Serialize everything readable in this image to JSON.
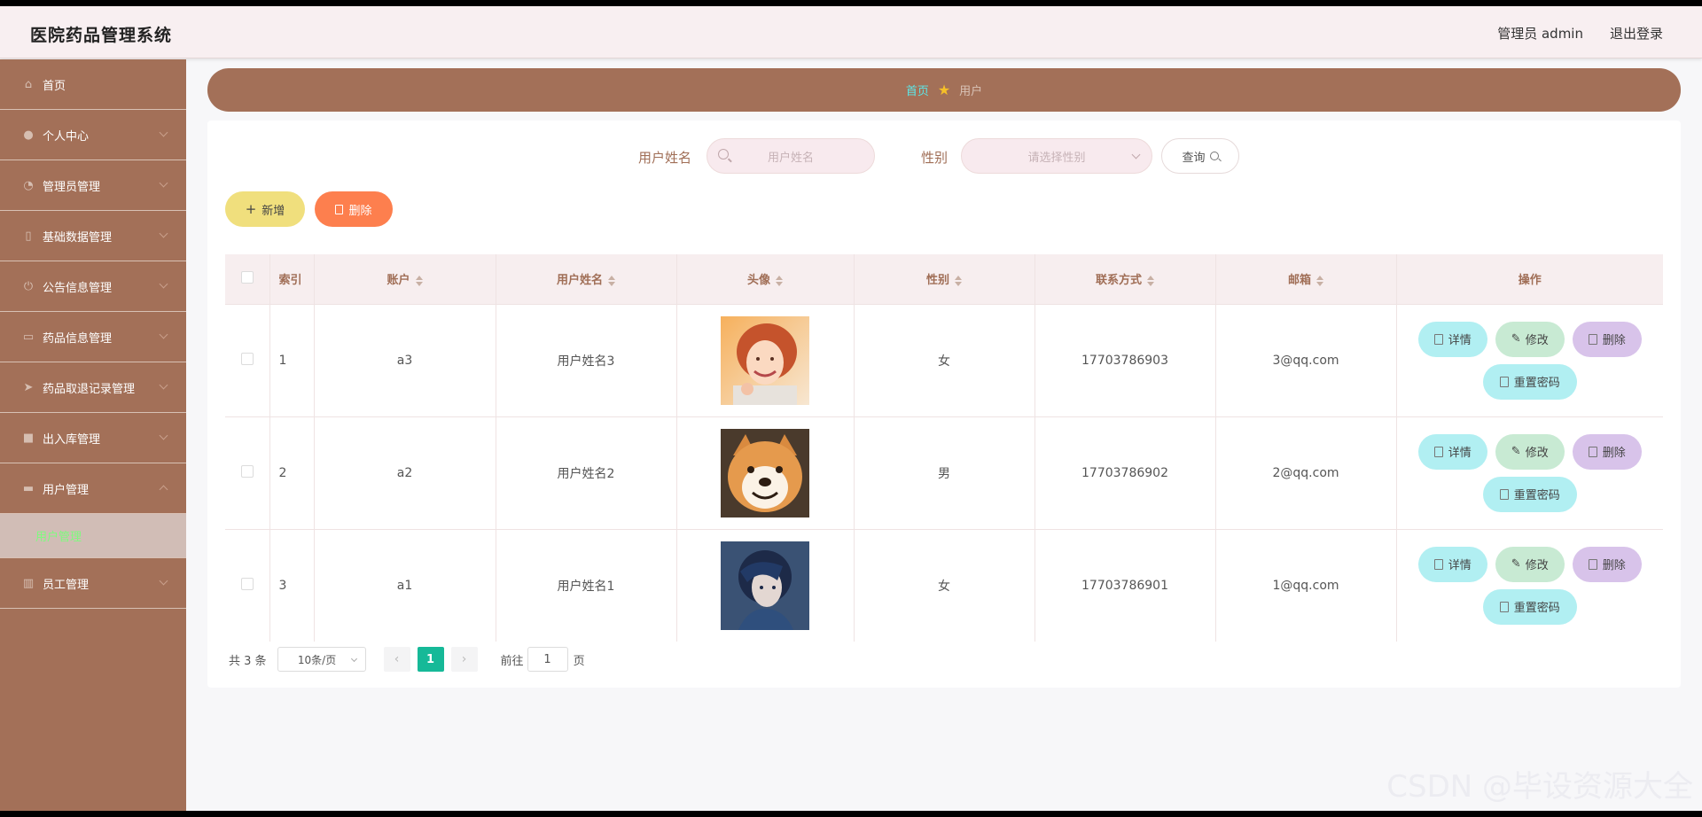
{
  "header": {
    "title": "医院药品管理系统",
    "admin": "管理员 admin",
    "logout": "退出登录"
  },
  "sidebar": {
    "items": [
      {
        "label": "首页",
        "icon": "home-icon",
        "glyph": "⌂"
      },
      {
        "label": "个人中心",
        "icon": "user-icon",
        "glyph": "●"
      },
      {
        "label": "管理员管理",
        "icon": "gauge-icon",
        "glyph": "◔"
      },
      {
        "label": "基础数据管理",
        "icon": "phone-icon",
        "glyph": "▯"
      },
      {
        "label": "公告信息管理",
        "icon": "power-icon",
        "glyph": "⏻"
      },
      {
        "label": "药品信息管理",
        "icon": "card-icon",
        "glyph": "▭"
      },
      {
        "label": "药品取退记录管理",
        "icon": "send-icon",
        "glyph": "➤"
      },
      {
        "label": "出入库管理",
        "icon": "box-icon",
        "glyph": "■"
      },
      {
        "label": "用户管理",
        "icon": "folder-icon",
        "glyph": "▬"
      },
      {
        "label": "员工管理",
        "icon": "chart-icon",
        "glyph": "▥"
      }
    ],
    "submenu": {
      "label": "用户管理"
    }
  },
  "breadcrumb": {
    "home": "首页",
    "current": "用户"
  },
  "search": {
    "name_label": "用户姓名",
    "name_placeholder": "用户姓名",
    "gender_label": "性别",
    "gender_placeholder": "请选择性别",
    "query_label": "查询"
  },
  "actions": {
    "add": "新增",
    "delete": "删除"
  },
  "table": {
    "headers": {
      "index": "索引",
      "account": "账户",
      "name": "用户姓名",
      "avatar": "头像",
      "gender": "性别",
      "phone": "联系方式",
      "email": "邮箱",
      "ops": "操作"
    },
    "rows": [
      {
        "index": "1",
        "account": "a3",
        "name": "用户姓名3",
        "gender": "女",
        "phone": "17703786903",
        "email": "3@qq.com"
      },
      {
        "index": "2",
        "account": "a2",
        "name": "用户姓名2",
        "gender": "男",
        "phone": "17703786902",
        "email": "2@qq.com"
      },
      {
        "index": "3",
        "account": "a1",
        "name": "用户姓名1",
        "gender": "女",
        "phone": "17703786901",
        "email": "1@qq.com"
      }
    ],
    "op_labels": {
      "detail": "详情",
      "edit": "修改",
      "delete": "删除",
      "reset": "重置密码"
    }
  },
  "pager": {
    "total": "共 3 条",
    "page_size": "10条/页",
    "prev": "‹",
    "current": "1",
    "next": "›",
    "goto_prefix": "前往",
    "goto_value": "1",
    "goto_suffix": "页"
  },
  "watermark": "CSDN @毕设资源大全"
}
